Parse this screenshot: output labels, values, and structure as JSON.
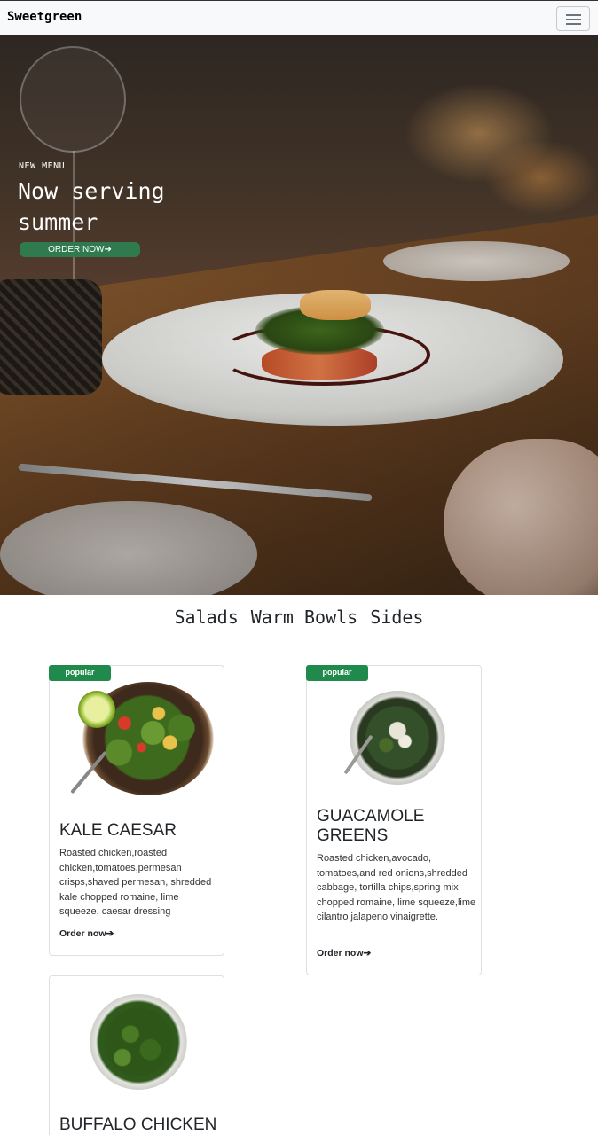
{
  "navbar": {
    "brand": "Sweetgreen",
    "menu_icon": "hamburger-menu-icon"
  },
  "hero": {
    "kicker": "NEW MENU",
    "title": "Now serving summer",
    "button_label": "ORDER NOW",
    "button_icon": "arrow-right-icon"
  },
  "categories": [
    "Salads",
    "Warm Bowls",
    "Sides"
  ],
  "cards": [
    {
      "badge": "popular",
      "title": "KALE CAESAR",
      "description": "Roasted chicken,roasted chicken,tomatoes,permesan crisps,shaved permesan, shredded kale chopped romaine, lime squeeze, caesar dressing",
      "order_label": "Order now"
    },
    {
      "badge": "popular",
      "title": "GUACAMOLE GREENS",
      "description": "Roasted chicken,avocado, tomatoes,and red onions,shredded cabbage, tortilla chips,spring mix chopped romaine, lime squeeze,lime cilantro jalapeno vinaigrette.",
      "order_label": "Order now"
    },
    {
      "title": "BUFFALO CHICKEN"
    }
  ],
  "colors": {
    "accent": "#1f8a4c",
    "hero_button": "#2f7a4e",
    "navbar_bg": "#f8f9fa"
  }
}
